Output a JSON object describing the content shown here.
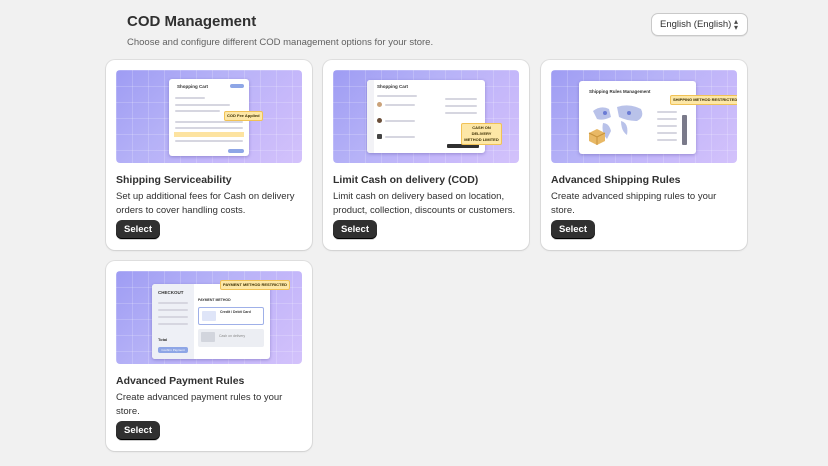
{
  "header": {
    "title": "COD Management",
    "subtitle": "Choose and configure different COD management options for your store."
  },
  "language_select": {
    "value": "English (English)"
  },
  "cards": [
    {
      "title": "Shipping Serviceability",
      "description": "Set up additional fees for Cash on delivery orders to cover handling costs.",
      "button": "Select",
      "thumb": {
        "heading": "Shopping Cart",
        "badge": "COD Fee Applied"
      }
    },
    {
      "title": "Limit Cash on delivery (COD)",
      "description": "Limit cash on delivery based on location, product, collection, discounts or customers.",
      "button": "Select",
      "thumb": {
        "heading": "Shopping Cart",
        "badge": "CASH ON DELIVERY METHOD LIMITED"
      }
    },
    {
      "title": "Advanced Shipping Rules",
      "description": "Create advanced shipping rules to your store.",
      "button": "Select",
      "thumb": {
        "heading": "Shipping Rules Management",
        "badge": "SHIPPING METHOD RESTRICTED"
      }
    },
    {
      "title": "Advanced Payment Rules",
      "description": "Create advanced payment rules to your store.",
      "button": "Select",
      "thumb": {
        "heading": "CHECKOUT",
        "badge": "PAYMENT METHOD RESTRICTED",
        "method_label": "PAYMENT METHOD",
        "option_card": "Credit / Debit Card",
        "option_cod": "Cash on delivery",
        "total_label": "Total",
        "cta": "Confirm Payment"
      }
    }
  ],
  "colors": {
    "accent_button": "#303030",
    "thumb_gradient_start": "#9e9cf3",
    "thumb_gradient_end": "#d3c2fb",
    "badge_fill": "#fde7a6"
  }
}
